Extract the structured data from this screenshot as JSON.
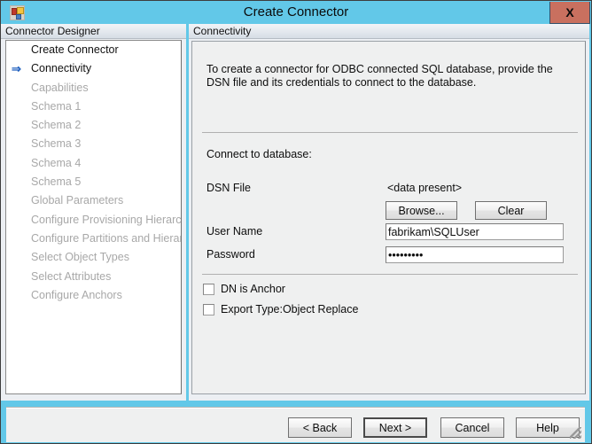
{
  "window": {
    "title": "Create Connector",
    "icon": "connector-designer-icon",
    "close_label": "X",
    "accent_color": "#62c8e8",
    "close_button_color": "#c9705f"
  },
  "sidebar": {
    "header": "Connector Designer",
    "current_marker": "⇒",
    "items": [
      {
        "label": "Create Connector",
        "state": "done"
      },
      {
        "label": "Connectivity",
        "state": "current"
      },
      {
        "label": "Capabilities",
        "state": "disabled"
      },
      {
        "label": "Schema 1",
        "state": "disabled"
      },
      {
        "label": "Schema 2",
        "state": "disabled"
      },
      {
        "label": "Schema 3",
        "state": "disabled"
      },
      {
        "label": "Schema 4",
        "state": "disabled"
      },
      {
        "label": "Schema 5",
        "state": "disabled"
      },
      {
        "label": "Global Parameters",
        "state": "disabled"
      },
      {
        "label": "Configure Provisioning Hierarchy",
        "state": "disabled"
      },
      {
        "label": "Configure Partitions and Hierarchies",
        "state": "disabled"
      },
      {
        "label": "Select Object Types",
        "state": "disabled"
      },
      {
        "label": "Select Attributes",
        "state": "disabled"
      },
      {
        "label": "Configure Anchors",
        "state": "disabled"
      }
    ]
  },
  "main": {
    "header": "Connectivity",
    "intro": "To create a connector for ODBC connected SQL database, provide the DSN file and its credentials to connect to the database.",
    "section_label": "Connect to database:",
    "dsn": {
      "label": "DSN File",
      "value": "<data present>",
      "browse_label": "Browse...",
      "clear_label": "Clear"
    },
    "username": {
      "label": "User Name",
      "value": "fabrikam\\SQLUser",
      "placeholder": ""
    },
    "password": {
      "label": "Password",
      "value": "•••••••••",
      "placeholder": ""
    },
    "checkboxes": [
      {
        "label": "DN is Anchor",
        "checked": false
      },
      {
        "label": "Export Type:Object Replace",
        "checked": false
      }
    ]
  },
  "footer": {
    "back_label": "< Back",
    "next_label": "Next  >",
    "cancel_label": "Cancel",
    "help_label": "Help",
    "default_button": "next"
  }
}
